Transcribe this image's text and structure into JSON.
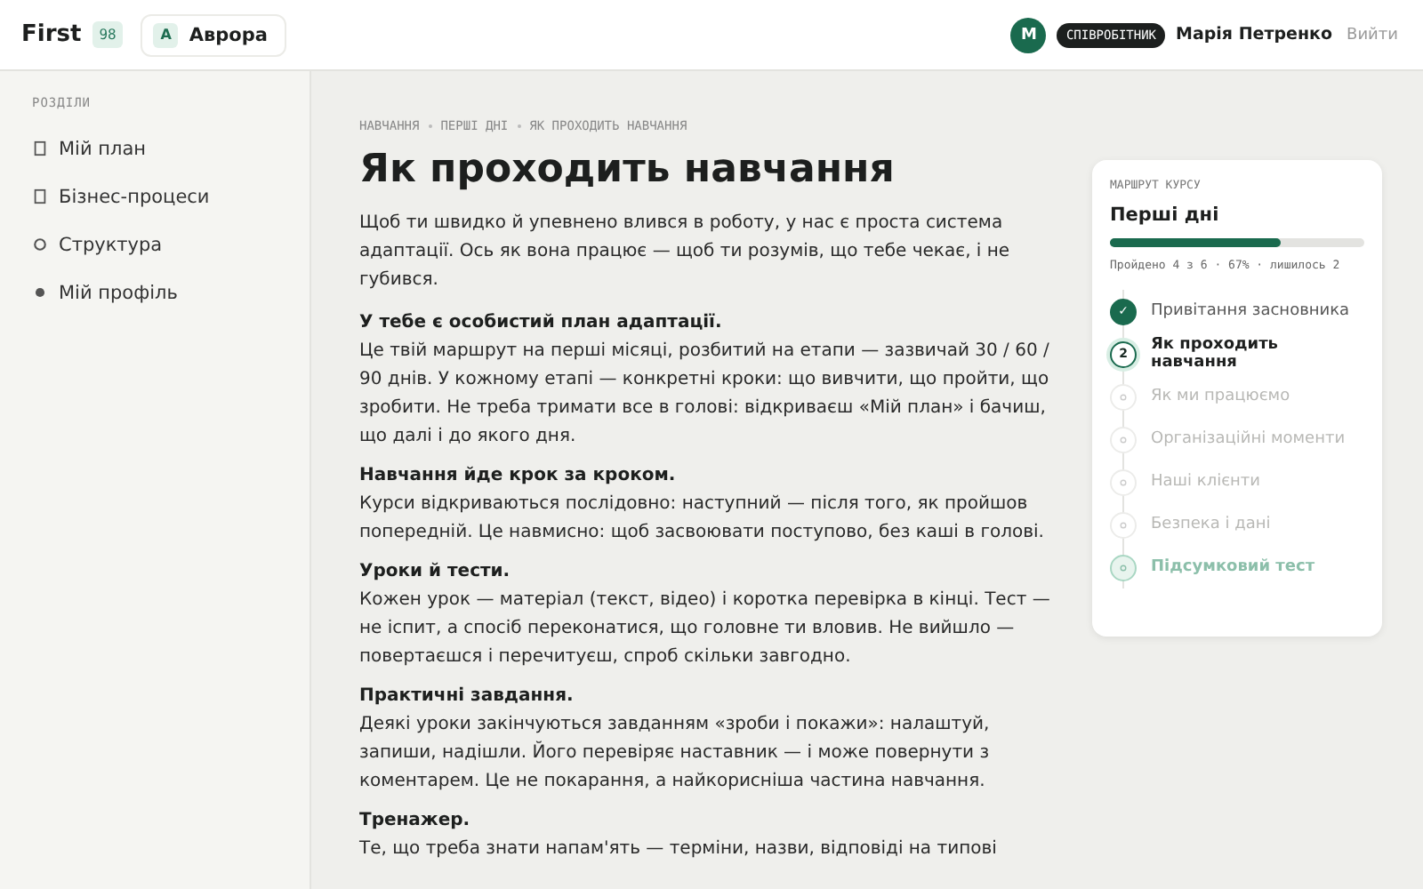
{
  "header": {
    "logo": "First",
    "logo_badge": "98",
    "workspace": {
      "initial": "А",
      "name": "Аврора"
    },
    "user": {
      "initial": "М",
      "role": "СПІВРОБІТНИК",
      "name": "Марія Петренко",
      "logout": "Вийти"
    }
  },
  "sidebar": {
    "title": "РОЗДІЛИ",
    "items": [
      {
        "label": "Мій план",
        "kind": "square",
        "selected": false
      },
      {
        "label": "Бізнес-процеси",
        "kind": "square",
        "selected": false
      },
      {
        "label": "Структура",
        "kind": "ring",
        "selected": false
      },
      {
        "label": "Мій профіль",
        "kind": "dot",
        "selected": false
      }
    ]
  },
  "breadcrumbs": [
    "НАВЧАННЯ",
    "ПЕРШІ ДНІ",
    "ЯК ПРОХОДИТЬ НАВЧАННЯ"
  ],
  "title": "Як проходить навчання",
  "intro": "Щоб ти швидко й упевнено влився в роботу, у нас є проста система адаптації. Ось як вона працює — щоб ти розумів, що тебе чекає, і не губився.",
  "sections": [
    {
      "heading": "У тебе є особистий план адаптації.",
      "text": "Це твій маршрут на перші місяці, розбитий на етапи — зазвичай 30 / 60 / 90 днів. У кожному етапі — конкретні кроки: що вивчити, що пройти, що зробити. Не треба тримати все в голові: відкриваєш «Мій план» і бачиш, що далі і до якого дня."
    },
    {
      "heading": "Навчання йде крок за кроком.",
      "text": "Курси відкриваються послідовно: наступний — після того, як пройшов попередній. Це навмисно: щоб засвоювати поступово, без каші в голові."
    },
    {
      "heading": "Уроки й тести.",
      "text": "Кожен урок — матеріал (текст, відео) і коротка перевірка в кінці. Тест — не іспит, а спосіб переконатися, що головне ти вловив. Не вийшло — повертаєшся і перечитуєш, спроб скільки завгодно."
    },
    {
      "heading": "Практичні завдання.",
      "text": "Деякі уроки закінчуються завданням «зроби і покажи»: налаштуй, запиши, надішли. Його перевіряє наставник — і може повернути з коментарем. Це не покарання, а найкорисніша частина навчання."
    },
    {
      "heading": "Тренажер.",
      "text": "Те, що треба знати напам'ять — терміни, назви, відповіді на типові"
    }
  ],
  "course": {
    "label": "МАРШРУТ КУРСУ",
    "title": "Перші дні",
    "level": 0.67,
    "progress_text": "Пройдено 4 з 6 · 67% · лишилось 2",
    "steps": [
      {
        "label": "Привітання засновника",
        "kind": "done",
        "marker": "✓"
      },
      {
        "label": "Як проходить навчання",
        "kind": "current",
        "marker": "2"
      },
      {
        "label": "Як ми працюємо",
        "kind": "locked"
      },
      {
        "label": "Організаційні моменти",
        "kind": "locked"
      },
      {
        "label": "Наші клієнти",
        "kind": "locked"
      },
      {
        "label": "Безпека і дані",
        "kind": "locked"
      },
      {
        "label": "Підсумковий тест",
        "kind": "test"
      }
    ]
  }
}
